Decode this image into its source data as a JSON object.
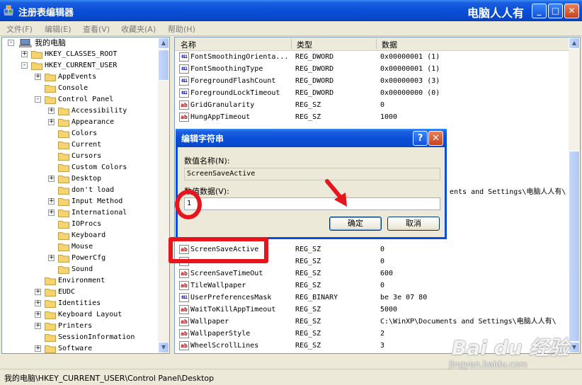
{
  "window": {
    "title": "注册表编辑器",
    "brand": "电脑人人有",
    "min_glyph": "_",
    "max_glyph": "□",
    "close_glyph": "✕"
  },
  "menu": [
    "文件(F)",
    "编辑(E)",
    "查看(V)",
    "收藏夹(A)",
    "帮助(H)"
  ],
  "tree": {
    "root": "我的电脑",
    "items": [
      {
        "label": "HKEY_CLASSES_ROOT",
        "exp": "+"
      },
      {
        "label": "HKEY_CURRENT_USER",
        "exp": "-"
      },
      {
        "label": "AppEvents",
        "exp": "+"
      },
      {
        "label": "Console",
        "exp": ""
      },
      {
        "label": "Control Panel",
        "exp": "-"
      },
      {
        "label": "Accessibility",
        "exp": "+"
      },
      {
        "label": "Appearance",
        "exp": "+"
      },
      {
        "label": "Colors",
        "exp": ""
      },
      {
        "label": "Current",
        "exp": ""
      },
      {
        "label": "Cursors",
        "exp": ""
      },
      {
        "label": "Custom Colors",
        "exp": ""
      },
      {
        "label": "Desktop",
        "exp": "+"
      },
      {
        "label": "don't load",
        "exp": ""
      },
      {
        "label": "Input Method",
        "exp": "+"
      },
      {
        "label": "International",
        "exp": "+"
      },
      {
        "label": "IOProcs",
        "exp": ""
      },
      {
        "label": "Keyboard",
        "exp": ""
      },
      {
        "label": "Mouse",
        "exp": ""
      },
      {
        "label": "PowerCfg",
        "exp": "+"
      },
      {
        "label": "Sound",
        "exp": ""
      },
      {
        "label": "Environment",
        "exp": ""
      },
      {
        "label": "EUDC",
        "exp": "+"
      },
      {
        "label": "Identities",
        "exp": "+"
      },
      {
        "label": "Keyboard Layout",
        "exp": "+"
      },
      {
        "label": "Printers",
        "exp": "+"
      },
      {
        "label": "SessionInformation",
        "exp": ""
      },
      {
        "label": "Software",
        "exp": "+"
      }
    ]
  },
  "list": {
    "headers": {
      "name": "名称",
      "type": "类型",
      "data": "数据"
    },
    "rows": [
      {
        "icon": "dword",
        "name": "FontSmoothingOrienta...",
        "type": "REG_DWORD",
        "data": "0x00000001 (1)"
      },
      {
        "icon": "dword",
        "name": "FontSmoothingType",
        "type": "REG_DWORD",
        "data": "0x00000001 (1)"
      },
      {
        "icon": "dword",
        "name": "ForegroundFlashCount",
        "type": "REG_DWORD",
        "data": "0x00000003 (3)"
      },
      {
        "icon": "dword",
        "name": "ForegroundLockTimeout",
        "type": "REG_DWORD",
        "data": "0x00000000 (0)"
      },
      {
        "icon": "sz",
        "name": "GridGranularity",
        "type": "REG_SZ",
        "data": "0"
      },
      {
        "icon": "sz",
        "name": "HungAppTimeout",
        "type": "REG_SZ",
        "data": "1000"
      },
      {
        "icon": "sz",
        "name": "ScreenSaveActive",
        "type": "REG_SZ",
        "data": "0"
      },
      {
        "icon": "sz",
        "name": "",
        "type": "REG_SZ",
        "data": "0"
      },
      {
        "icon": "sz",
        "name": "ScreenSaveTimeOut",
        "type": "REG_SZ",
        "data": "600"
      },
      {
        "icon": "sz",
        "name": "TileWallpaper",
        "type": "REG_SZ",
        "data": "0"
      },
      {
        "icon": "bin",
        "name": "UserPreferencesMask",
        "type": "REG_BINARY",
        "data": "be 3e 07 80"
      },
      {
        "icon": "sz",
        "name": "WaitToKillAppTimeout",
        "type": "REG_SZ",
        "data": "5000"
      },
      {
        "icon": "sz",
        "name": "Wallpaper",
        "type": "REG_SZ",
        "data": "C:\\WinXP\\Documents and Settings\\电脑人人有\\"
      },
      {
        "icon": "sz",
        "name": "WallpaperStyle",
        "type": "REG_SZ",
        "data": "2"
      },
      {
        "icon": "sz",
        "name": "WheelScrollLines",
        "type": "REG_SZ",
        "data": "3"
      }
    ],
    "partial_data": "ents and Settings\\电脑人人有\\"
  },
  "status": "我的电脑\\HKEY_CURRENT_USER\\Control Panel\\Desktop",
  "dialog": {
    "title": "编辑字符串",
    "value_name_label": "数值名称(N):",
    "value_name": "ScreenSaveActive",
    "value_data_label": "数值数据(V):",
    "value_data": "1",
    "ok": "确定",
    "cancel": "取消",
    "help_glyph": "?",
    "close_glyph": "✕"
  },
  "watermark": {
    "logo": "Bai du 经验",
    "url": "jingyan.baidu.com"
  },
  "colors": {
    "xp_blue": "#0a4ed8",
    "annotation_red": "#e8141c",
    "face": "#ece9d8"
  }
}
